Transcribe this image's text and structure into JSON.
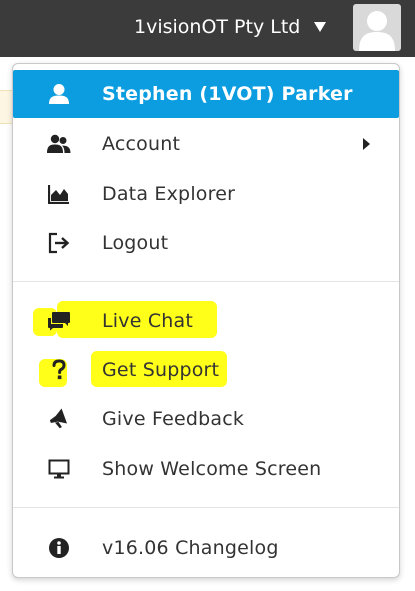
{
  "header": {
    "org_name": "1visionOT Pty Ltd",
    "dropdown_icon": "caret-down-icon",
    "avatar_icon": "user-avatar-icon"
  },
  "menu": {
    "user_item": {
      "label": "Stephen (1VOT) Parker",
      "icon": "user-icon"
    },
    "account": {
      "label": "Account",
      "icon": "users-icon",
      "submenu_icon": "chevron-right-icon"
    },
    "data_explorer": {
      "label": "Data Explorer",
      "icon": "area-chart-icon"
    },
    "logout": {
      "label": "Logout",
      "icon": "sign-out-icon"
    },
    "live_chat": {
      "label": "Live Chat",
      "icon": "chat-bubbles-icon"
    },
    "get_support": {
      "label": "Get Support",
      "icon": "question-mark-icon"
    },
    "give_feedback": {
      "label": "Give Feedback",
      "icon": "megaphone-icon"
    },
    "welcome_screen": {
      "label": "Show Welcome Screen",
      "icon": "monitor-icon"
    },
    "changelog": {
      "label": "v16.06 Changelog",
      "icon": "info-circle-icon"
    }
  },
  "colors": {
    "topbar": "#3b3b3b",
    "active_item": "#0b9de0",
    "highlight": "#ffff1a",
    "text": "#333333"
  }
}
